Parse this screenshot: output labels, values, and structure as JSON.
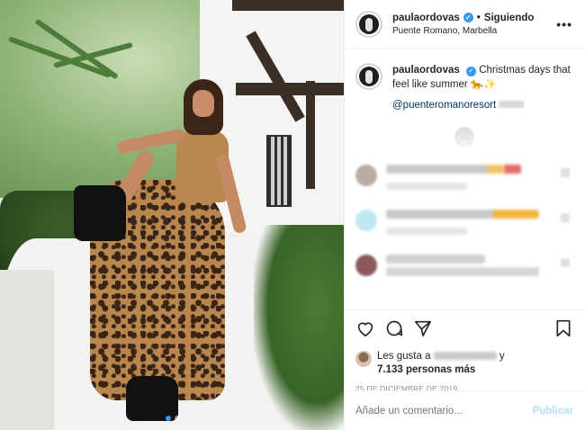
{
  "post": {
    "username": "paulaordovas",
    "follow_status": "Siguiendo",
    "location": "Puente Romano, Marbella",
    "caption": {
      "username": "paulaordovas",
      "text": "Christmas days that feel like summer 🐆✨",
      "mention": "@puenteromanoresort"
    },
    "likes": {
      "prefix": "Les gusta a",
      "suffix": "y",
      "count_text": "7.133 personas más"
    },
    "date": "25 DE DICIEMBRE DE 2019",
    "carousel": {
      "total": 2,
      "active": 1
    }
  },
  "comment_box": {
    "placeholder": "Añade un comentario...",
    "post_label": "Publicar"
  },
  "icons": {
    "verified": "verified-badge-icon",
    "more": "more-options-icon",
    "like": "heart-icon",
    "comment": "comment-icon",
    "share": "share-icon",
    "save": "bookmark-icon"
  },
  "colors": {
    "accent": "#3897f0",
    "link": "#003569",
    "muted": "#8e8e8e",
    "post_disabled": "#b2dffc"
  }
}
